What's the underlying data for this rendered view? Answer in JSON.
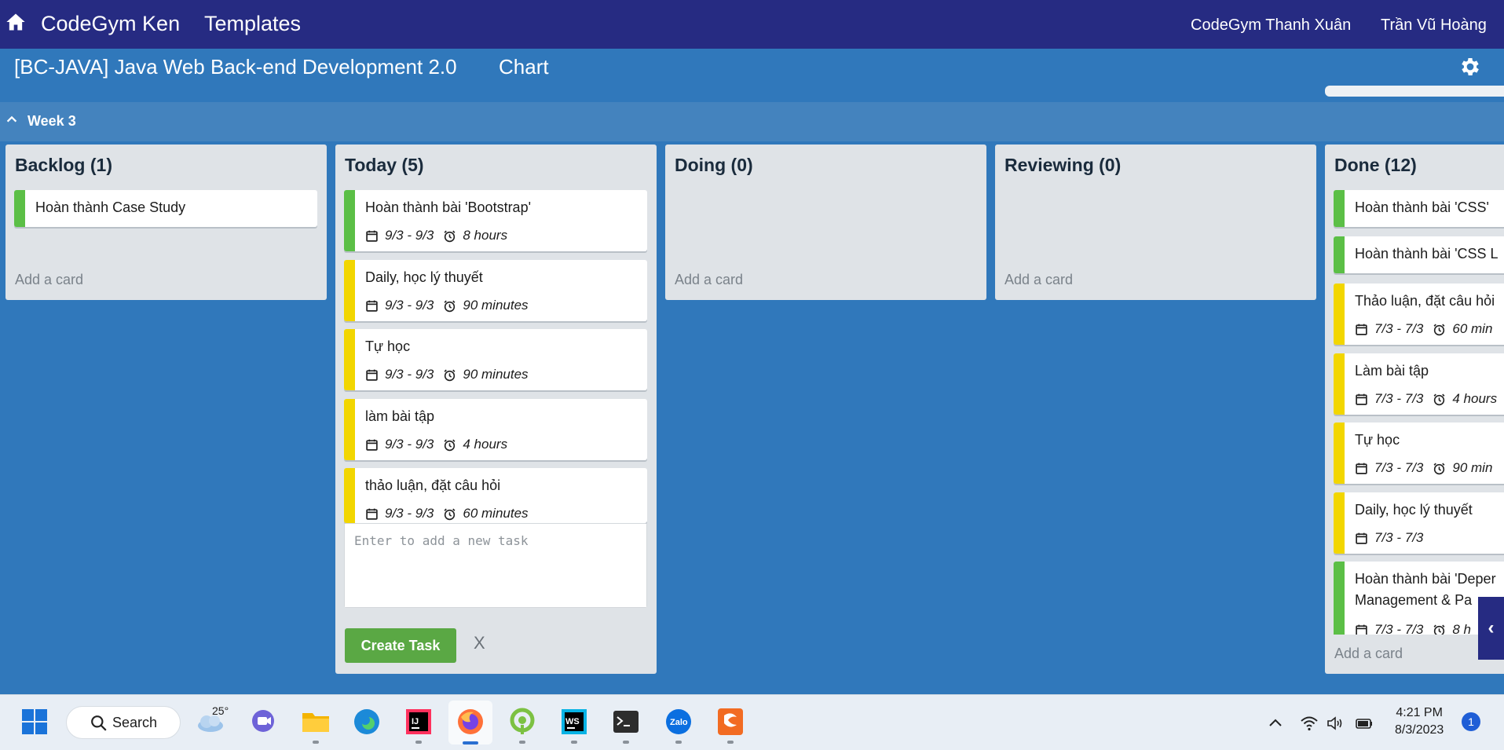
{
  "topbar": {
    "brand": "CodeGym Ken",
    "templates": "Templates",
    "org": "CodeGym Thanh Xuân",
    "user": "Trần Vũ Hoàng"
  },
  "subbar": {
    "course": "[BC-JAVA] Java Web Back-end Development 2.0",
    "chart_link": "Chart"
  },
  "week": {
    "label": "Week 3"
  },
  "columns": [
    {
      "title": "Backlog (1)",
      "add_card": "Add a card",
      "cards": [
        {
          "title": "Hoàn thành Case Study",
          "color": "#5bbf46"
        }
      ]
    },
    {
      "title": "Today (5)",
      "cards": [
        {
          "title": "Hoàn thành bài 'Bootstrap'",
          "date": "9/3 - 9/3",
          "duration": "8 hours",
          "color": "#5bbf46"
        },
        {
          "title": "Daily, học lý thuyết",
          "date": "9/3 - 9/3",
          "duration": "90 minutes",
          "color": "#f2d600"
        },
        {
          "title": "Tự học",
          "date": "9/3 - 9/3",
          "duration": "90 minutes",
          "color": "#f2d600"
        },
        {
          "title": "làm bài tập",
          "date": "9/3 - 9/3",
          "duration": "4 hours",
          "color": "#f2d600"
        },
        {
          "title": "thảo luận, đặt câu hỏi",
          "date": "9/3 - 9/3",
          "duration": "60 minutes",
          "color": "#f2d600"
        }
      ],
      "new_task_placeholder": "Enter to add a new task",
      "create_label": "Create Task",
      "cancel_label": "X"
    },
    {
      "title": "Doing (0)",
      "add_card": "Add a card"
    },
    {
      "title": "Reviewing (0)",
      "add_card": "Add a card"
    },
    {
      "title": "Done (12)",
      "add_card": "Add a card",
      "cards": [
        {
          "title": "Hoàn thành bài 'CSS'",
          "color": "#5bbf46"
        },
        {
          "title": "Hoàn thành bài 'CSS L",
          "color": "#5bbf46"
        },
        {
          "title": "Thảo luận, đặt câu hỏi",
          "date": "7/3 - 7/3",
          "duration": "60 min",
          "color": "#f2d600"
        },
        {
          "title": "Làm bài tập",
          "date": "7/3 - 7/3",
          "duration": "4 hours",
          "color": "#f2d600"
        },
        {
          "title": "Tự học",
          "date": "7/3 - 7/3",
          "duration": "90 min",
          "color": "#f2d600"
        },
        {
          "title": "Daily, học lý thuyết",
          "date": "7/3 - 7/3",
          "color": "#f2d600"
        },
        {
          "title": "Hoàn thành bài 'Deper",
          "title_line2": "Management & Pa",
          "date": "7/3 - 7/3",
          "duration": "8 h",
          "color": "#5bbf46"
        }
      ]
    }
  ],
  "side_tab": "‹",
  "taskbar": {
    "search_label": "Search",
    "weather_temp": "25°",
    "time": "4:21 PM",
    "date": "8/3/2023",
    "notification_count": "1",
    "apps": [
      "windows-start",
      "weather",
      "teams-chat",
      "file-explorer",
      "edge",
      "intellij",
      "firefox",
      "sourcetree",
      "webstorm",
      "terminal",
      "zalo",
      "foxit-pdf"
    ]
  }
}
